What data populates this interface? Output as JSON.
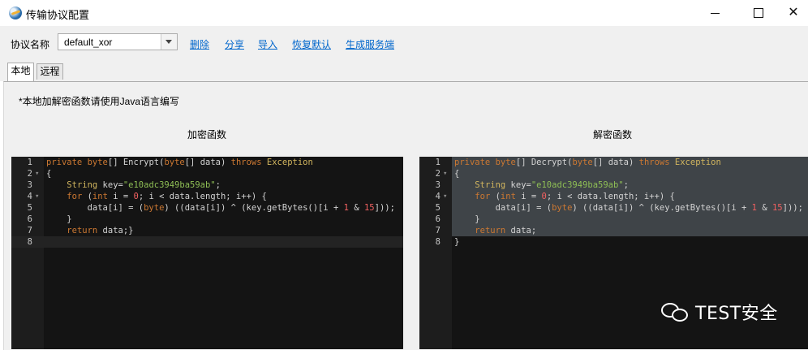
{
  "window": {
    "title": "传输协议配置",
    "controls": {
      "minimize": "—",
      "maximize": "☐",
      "close": "✕"
    }
  },
  "toolbar": {
    "protocol_label": "协议名称",
    "protocol_value": "default_xor",
    "links": {
      "delete": "删除",
      "share": "分享",
      "import": "导入",
      "reset": "恢复默认",
      "generate_server": "生成服务端"
    }
  },
  "tabs": {
    "local": "本地",
    "remote": "远程",
    "active": "本地"
  },
  "note": "*本地加解密函数请使用Java语言编写",
  "encrypt": {
    "title": "加密函数",
    "lines": [
      {
        "n": "1",
        "fold": "",
        "html": "<span class=\"kw\">private</span> <span class=\"kw\">byte</span>[] Encrypt(<span class=\"kw\">byte</span>[] data) <span class=\"kw\">throws</span> <span class=\"cl\">Exception</span>"
      },
      {
        "n": "2",
        "fold": "▾",
        "html": "{"
      },
      {
        "n": "3",
        "fold": "",
        "html": "    <span class=\"cl\">String</span> key=<span class=\"str\">\"e10adc3949ba59ab\"</span>;"
      },
      {
        "n": "4",
        "fold": "▾",
        "html": "    <span class=\"kw\">for</span> (<span class=\"kw\">int</span> i = <span class=\"num-lit\">0</span>; i &lt; data.length; i++) {"
      },
      {
        "n": "5",
        "fold": "",
        "html": "        data[i] = (<span class=\"kw\">byte</span>) ((data[i]) ^ (key.getBytes()[i + <span class=\"num-lit\">1</span> &amp; <span class=\"num-lit\">15</span>]));"
      },
      {
        "n": "6",
        "fold": "",
        "html": "    }"
      },
      {
        "n": "7",
        "fold": "",
        "html": "    <span class=\"kw\">return</span> data;}"
      },
      {
        "n": "8",
        "fold": "",
        "html": ""
      }
    ]
  },
  "decrypt": {
    "title": "解密函数",
    "lines": [
      {
        "n": "1",
        "fold": "",
        "html": "<span class=\"kw\">private</span> <span class=\"kw\">byte</span>[] Decrypt(<span class=\"kw\">byte</span>[] data) <span class=\"kw\">throws</span> <span class=\"cl\">Exception</span>"
      },
      {
        "n": "2",
        "fold": "▾",
        "html": "{"
      },
      {
        "n": "3",
        "fold": "",
        "html": "    <span class=\"cl\">String</span> key=<span class=\"str\">\"e10adc3949ba59ab\"</span>;"
      },
      {
        "n": "4",
        "fold": "▾",
        "html": "    <span class=\"kw\">for</span> (<span class=\"kw\">int</span> i = <span class=\"num-lit\">0</span>; i &lt; data.length; i++) {"
      },
      {
        "n": "5",
        "fold": "",
        "html": "        data[i] = (<span class=\"kw\">byte</span>) ((data[i]) ^ (key.getBytes()[i + <span class=\"num-lit\">1</span> &amp; <span class=\"num-lit\">15</span>]));"
      },
      {
        "n": "6",
        "fold": "",
        "html": "    }"
      },
      {
        "n": "7",
        "fold": "",
        "html": "    <span class=\"kw\">return</span> data;"
      },
      {
        "n": "8",
        "fold": "",
        "html": "}"
      }
    ]
  },
  "watermark": {
    "text": "TEST安全",
    "icon": "wechat-icon"
  },
  "colors": {
    "editor_bg": "#141414",
    "keyword": "#cc7832",
    "string": "#8fbf55",
    "link": "#0066cc"
  }
}
